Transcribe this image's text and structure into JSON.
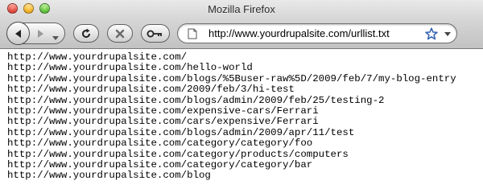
{
  "window": {
    "title": "Mozilla Firefox"
  },
  "toolbar": {
    "back_icon": "back-arrow-icon",
    "forward_icon": "forward-arrow-icon",
    "reload_icon": "reload-icon",
    "stop_icon": "stop-icon",
    "home_icon": "key-icon"
  },
  "urlbar": {
    "value": "http://www.yourdrupalsite.com/urllist.txt",
    "bookmark_icon": "star-icon"
  },
  "content": {
    "lines": [
      "http://www.yourdrupalsite.com/",
      "http://www.yourdrupalsite.com/hello-world",
      "http://www.yourdrupalsite.com/blogs/%5Buser-raw%5D/2009/feb/7/my-blog-entry",
      "http://www.yourdrupalsite.com/2009/feb/3/hi-test",
      "http://www.yourdrupalsite.com/blogs/admin/2009/feb/25/testing-2",
      "http://www.yourdrupalsite.com/expensive-cars/Ferrari",
      "http://www.yourdrupalsite.com/cars/expensive/Ferrari",
      "http://www.yourdrupalsite.com/blogs/admin/2009/apr/11/test",
      "http://www.yourdrupalsite.com/category/category/foo",
      "http://www.yourdrupalsite.com/category/products/computers",
      "http://www.yourdrupalsite.com/category/category/bar",
      "http://www.yourdrupalsite.com/blog"
    ]
  }
}
